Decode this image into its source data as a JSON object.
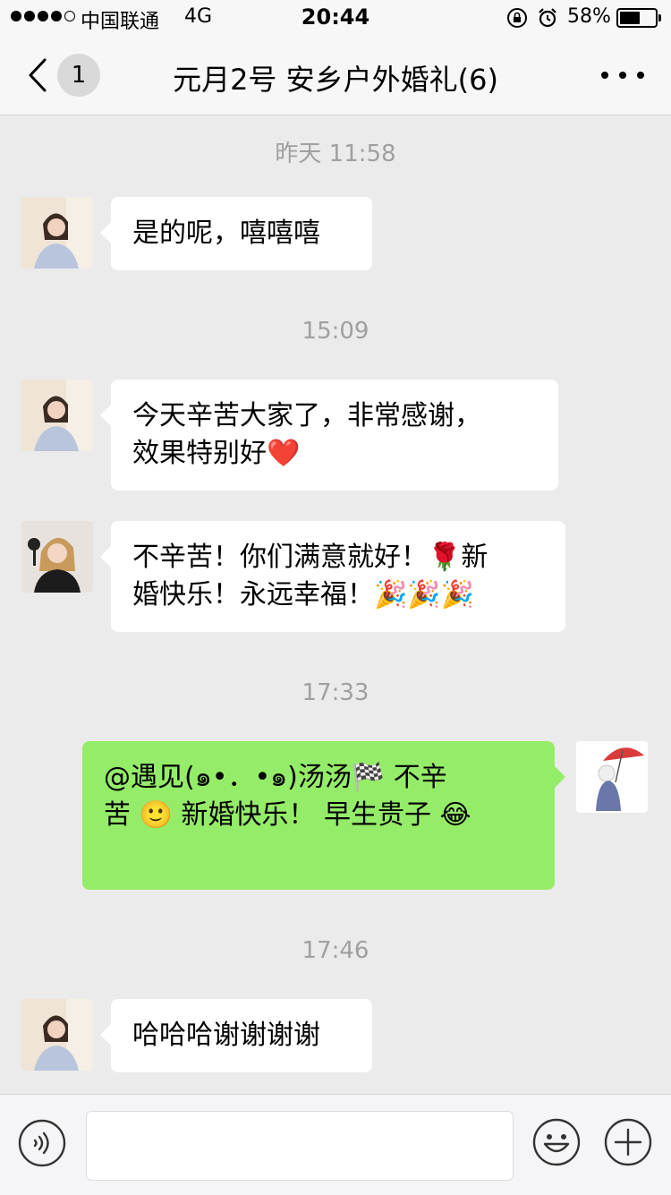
{
  "status_bar": {
    "carrier": "中国联通",
    "network": "4G",
    "time": "20:44",
    "battery": "58%",
    "battery_level": 0.58
  },
  "nav": {
    "unread_count": "1",
    "title": "元月2号 安乡户外婚礼(6)"
  },
  "chat": {
    "timestamps": [
      "昨天 11:58",
      "15:09",
      "17:33",
      "17:46"
    ],
    "messages": [
      {
        "line1": "是的呢，嘻嘻嘻"
      },
      {
        "line1": "今天辛苦大家了，非常感谢，",
        "line2": "效果特别好❤️"
      },
      {
        "line1": "不辛苦！你们满意就好！🌹新",
        "line2": "婚快乐！永远幸福！🎉🎉🎉"
      },
      {
        "line1": "@遇见(๑•．•๑)汤汤🏁    不辛",
        "line2": "苦 🙂 新婚快乐！ 早生贵子 😂"
      },
      {
        "line1": "哈哈哈谢谢谢谢"
      }
    ]
  },
  "icons": {
    "back": "chevron-left-icon",
    "more": "more-dots-icon",
    "voice": "voice-icon",
    "emoji": "emoji-icon",
    "plus": "plus-icon"
  }
}
